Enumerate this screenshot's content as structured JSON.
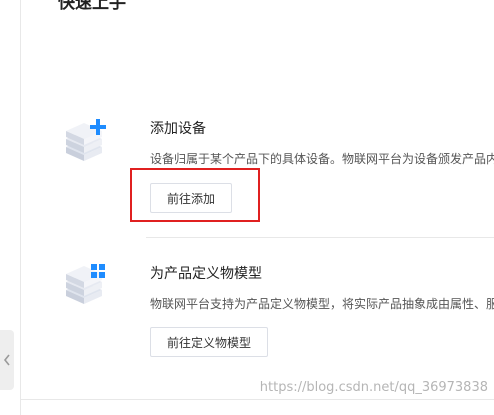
{
  "page": {
    "heading": "快速上手"
  },
  "steps": [
    {
      "title": "添加设备",
      "description": "设备归属于某个产品下的具体设备。物联网平台为设备颁发产品内",
      "button_label": "前往添加",
      "icon": "add-device-icon"
    },
    {
      "title": "为产品定义物模型",
      "description": "物联网平台支持为产品定义物模型，将实际产品抽象成由属性、服",
      "button_label": "前往定义物模型",
      "icon": "thing-model-icon"
    }
  ],
  "watermark": "https://blog.csdn.net/qq_36973838",
  "colors": {
    "highlight": "#e02020",
    "icon_blue": "#1e8cff",
    "border": "#dcdfe6"
  }
}
